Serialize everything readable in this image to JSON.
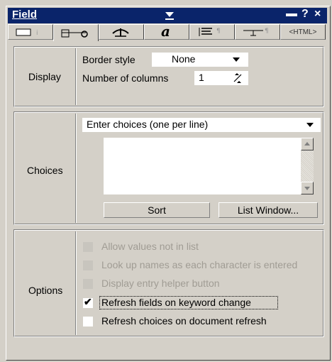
{
  "titlebar": {
    "title": "Field",
    "help": "?",
    "close": "×"
  },
  "tabs": [
    {
      "icon": "field-info-icon"
    },
    {
      "icon": "control-icon"
    },
    {
      "icon": "hide-when-icon"
    },
    {
      "icon": "font-icon"
    },
    {
      "icon": "paragraph-alignment-icon"
    },
    {
      "icon": "paragraph-margins-icon"
    },
    {
      "icon": "html-tag-icon",
      "label": "<HTML>"
    }
  ],
  "display": {
    "label": "Display",
    "border_style_label": "Border style",
    "border_style_value": "None",
    "columns_label": "Number of columns",
    "columns_value": "1"
  },
  "choices": {
    "label": "Choices",
    "source_value": "Enter choices (one per line)",
    "sort_label": "Sort",
    "list_window_label": "List Window..."
  },
  "options": {
    "label": "Options",
    "items": [
      {
        "label": "Allow values not in list",
        "checked": false,
        "enabled": false
      },
      {
        "label": "Look up names as each character is entered",
        "checked": false,
        "enabled": false
      },
      {
        "label": "Display entry helper button",
        "checked": false,
        "enabled": false
      },
      {
        "label": "Refresh fields on keyword change",
        "checked": true,
        "enabled": true
      },
      {
        "label": "Refresh choices on document refresh",
        "checked": false,
        "enabled": true
      }
    ]
  },
  "colors": {
    "titlebar": "#0a246a",
    "face": "#d4d0c8",
    "disabled_text": "#a09c94"
  }
}
